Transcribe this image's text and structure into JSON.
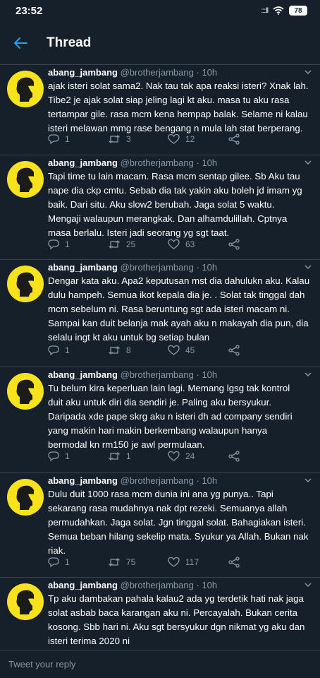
{
  "status": {
    "time": "23:52",
    "signal": "::::ll",
    "battery": "78"
  },
  "header": {
    "title": "Thread"
  },
  "colors": {
    "background": "#15202b",
    "muted": "#8899a6",
    "avatar": "#f7e21b",
    "divider": "#38444d"
  },
  "tweets": [
    {
      "name": "abang_jambang",
      "handle": "@brotherjambang",
      "dot": "·",
      "ago": "10h",
      "lines": [
        "ajak isteri solat sama2. Nak tau tak apa reaksi isteri? Xnak lah.",
        "Tibe2 je ajak solat siap jeling lagi kt aku. masa tu aku rasa",
        "tertampar gile. rasa mcm kena hempap balak. Selame ni kalau",
        "isteri melawan mmg rase bengang n mula lah stat berperang."
      ],
      "replies": "1",
      "retweets": "3",
      "likes": "12"
    },
    {
      "name": "abang_jambang",
      "handle": "@brotherjambang",
      "dot": "·",
      "ago": "10h",
      "lines": [
        "Tapi time tu lain macam. Rasa mcm sentap gilee. Sb Aku tau",
        "nape dia ckp cmtu. Sebab dia tak yakin aku boleh jd imam yg",
        "baik. Dari situ. Aku slow2 berubah. Jaga solat 5 waktu.",
        "Mengaji walaupun merangkak. Dan alhamdulillah. Cptnya",
        "masa berlalu. Isteri jadi seorang yg sgt taat."
      ],
      "replies": "1",
      "retweets": "25",
      "likes": "63"
    },
    {
      "name": "abang_jambang",
      "handle": "@brotherjambang",
      "dot": "·",
      "ago": "10h",
      "lines": [
        "Dengar kata aku. Apa2 keputusan mst dia dahulukn aku. Kalau",
        "dulu hampeh. Semua ikot kepala dia je. . Solat tak tinggal dah",
        "mcm sebelum ni. Rasa beruntung sgt ada isteri macam ni.",
        "Sampai kan duit belanja mak ayah aku n makayah dia pun, dia",
        "selalu ingt kt aku untuk bg setiap bulan"
      ],
      "replies": "1",
      "retweets": "8",
      "likes": "45"
    },
    {
      "name": "abang_jambang",
      "handle": "@brotherjambang",
      "dot": "·",
      "ago": "10h",
      "lines": [
        "Tu belum kira keperluan lain lagi. Memang lgsg tak kontrol",
        "duit aku untuk diri dia sendiri je. Paling aku bersyukur.",
        "Daripada xde pape skrg aku n isteri dh ad company sendiri",
        "yang makin hari makin berkembang walaupun hanya",
        "bermodal kn rm150 je awl permulaan."
      ],
      "replies": "1",
      "retweets": "1",
      "likes": "24"
    },
    {
      "name": "abang_jambang",
      "handle": "@brotherjambang",
      "dot": "·",
      "ago": "10h",
      "lines": [
        "Dulu duit 1000 rasa mcm dunia ini ana yg punya.. Tapi",
        "sekarang rasa mudahnya nak dpt rezeki. Semuanya allah",
        "permudahkan. Jaga solat. Jgn tinggal solat. Bahagiakan isteri.",
        "Semua beban hilang sekelip mata. Syukur ya Allah. Bukan nak",
        "riak."
      ],
      "replies": "1",
      "retweets": "75",
      "likes": "117"
    },
    {
      "name": "abang_jambang",
      "handle": "@brotherjambang",
      "dot": "·",
      "ago": "10h",
      "lines": [
        "Tp aku dambakan pahala kalau2 ada yg terdetik hati nak jaga",
        "solat asbab baca karangan aku ni. Percayalah. Bukan cerita",
        "kosong. Sbb hari ni. Aku sgt bersyukur dgn nikmat yg aku dan",
        "isteri terima 2020 ni"
      ]
    }
  ],
  "reply": {
    "placeholder": "Tweet your reply"
  }
}
